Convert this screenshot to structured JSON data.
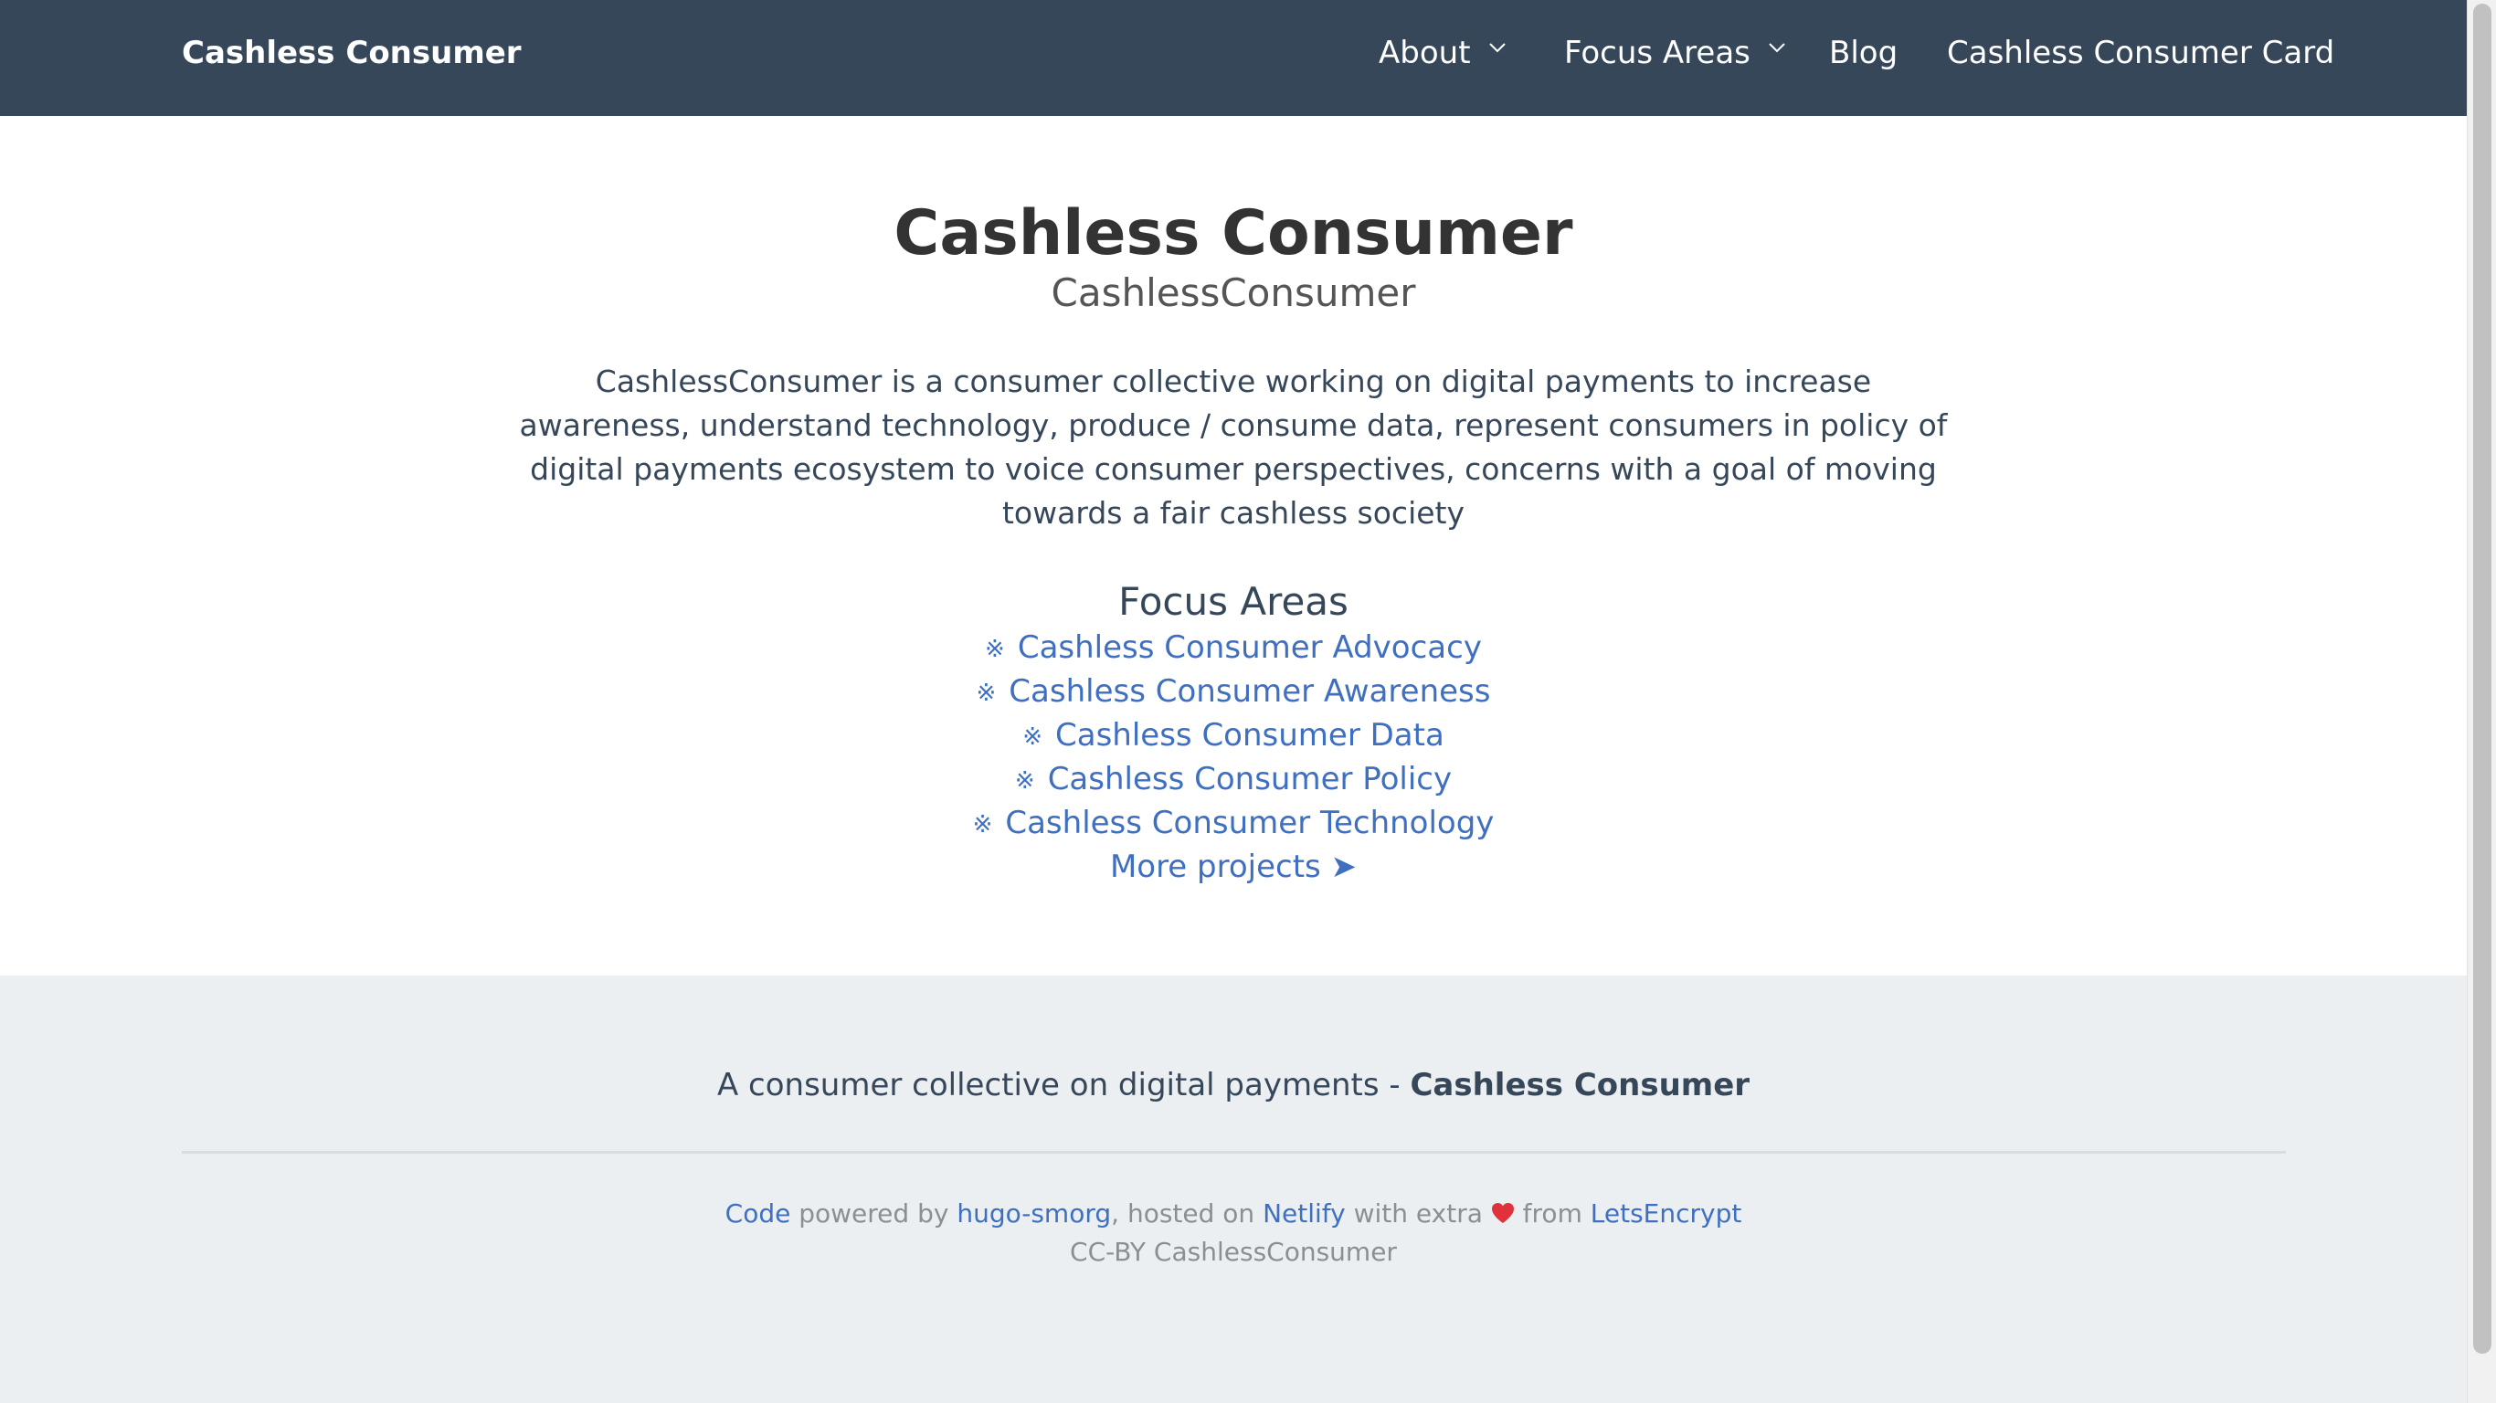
{
  "navbar": {
    "brand": "Cashless Consumer",
    "items": [
      {
        "label": "About",
        "dropdown": true
      },
      {
        "label": "Focus Areas",
        "dropdown": true
      },
      {
        "label": "Blog",
        "dropdown": false
      },
      {
        "label": "Cashless Consumer Card",
        "dropdown": false
      }
    ],
    "background_color": "#37475a"
  },
  "hero": {
    "title": "Cashless Consumer",
    "subtitle": "CashlessConsumer",
    "description": "CashlessConsumer is a consumer collective working on digital payments to increase awareness, understand technology, produce / consume data, represent consumers in policy of digital payments ecosystem to voice consumer perspectives, concerns with a goal of moving towards a fair cashless society"
  },
  "focus_areas": {
    "heading": "Focus Areas",
    "bullet": "※",
    "items": [
      {
        "label": "Cashless Consumer Advocacy"
      },
      {
        "label": "Cashless Consumer Awareness"
      },
      {
        "label": "Cashless Consumer Data"
      },
      {
        "label": "Cashless Consumer Policy"
      },
      {
        "label": "Cashless Consumer Technology"
      }
    ],
    "more_label": "More projects ➤",
    "link_color": "#3f6fc0"
  },
  "footer": {
    "tagline_prefix": "A consumer collective on digital payments - ",
    "tagline_bold": "Cashless Consumer",
    "credits": {
      "code_link": "Code",
      "powered_by": " powered by ",
      "theme_link": "hugo-smorg",
      "hosted_on": ", hosted on ",
      "host_link": "Netlify",
      "with_extra": " with extra ",
      "heart_icon": "heart-icon",
      "from": " from ",
      "ssl_link": "LetsEncrypt"
    },
    "license": "CC-BY CashlessConsumer",
    "background_color": "#eceff1"
  }
}
